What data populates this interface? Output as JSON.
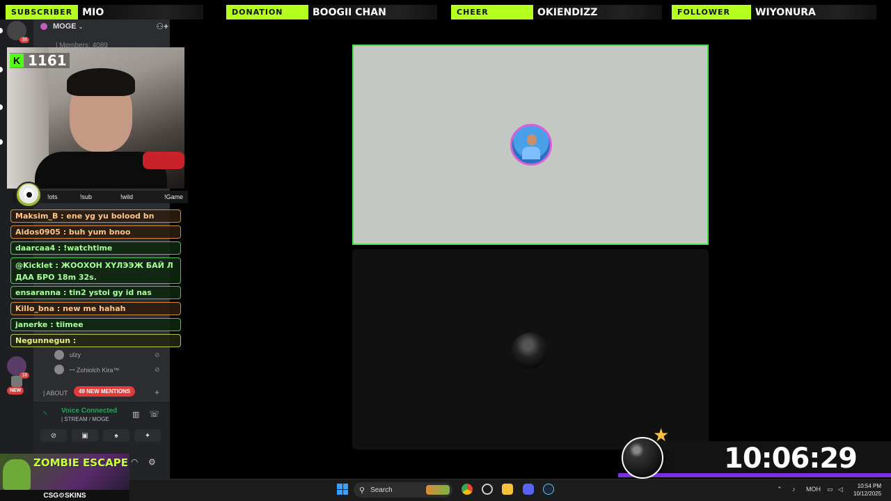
{
  "alerts": [
    {
      "tag": "SUBSCRIBER",
      "value": "MIO"
    },
    {
      "tag": "DONATION",
      "value": "BOOGII CHAN"
    },
    {
      "tag": "CHEER",
      "value": "OKIENDIZZ"
    },
    {
      "tag": "FOLLOWER",
      "value": "WIYONURA"
    }
  ],
  "discord": {
    "server_name": "MOGE",
    "members": "| Members: 4089",
    "server_badges": [
      "38",
      "18",
      "18"
    ],
    "new_pill": "NEW",
    "about": "| ABOUT",
    "mentions": "49 NEW MENTIONS",
    "voice_title": "Voice Connected",
    "voice_sub": "| STREAM / MOGE",
    "member_list": [
      "ulzy",
      "ꟷ Zohiolch Kira™"
    ]
  },
  "stream": {
    "follower_count": "1161",
    "commands": [
      "!ots",
      "!sub",
      "!wild",
      "!Game"
    ]
  },
  "chat": [
    {
      "text": "Maksim_B : ene yg yu bolood bn",
      "style": "orange"
    },
    {
      "text": "Aidos0905 : buh yum bnoo",
      "style": "orange"
    },
    {
      "text": "daarcaa4 : !watchtime",
      "style": "green"
    },
    {
      "text": "@Kicklet : ЖООХОН ХҮЛЭЭЖ БАЙ Л ДАА БРО 18m 32s.",
      "style": "green"
    },
    {
      "text": "ensaranna : tin2 ystoi gy id nas",
      "style": "green"
    },
    {
      "text": "Killo_bna : new me hahah",
      "style": "orange"
    },
    {
      "text": "janerke : tiimee",
      "style": "green"
    },
    {
      "text": "Negunnegun :",
      "style": "yellow"
    }
  ],
  "promo": {
    "title": "ZOMBIE ESCAPE",
    "brand": "CSG⚙SKINS"
  },
  "timer": {
    "value": "10:06:29"
  },
  "taskbar": {
    "search_label": "Search",
    "tray_lang": "МОН",
    "time": "10:54 PM",
    "date": "10/12/2025"
  }
}
